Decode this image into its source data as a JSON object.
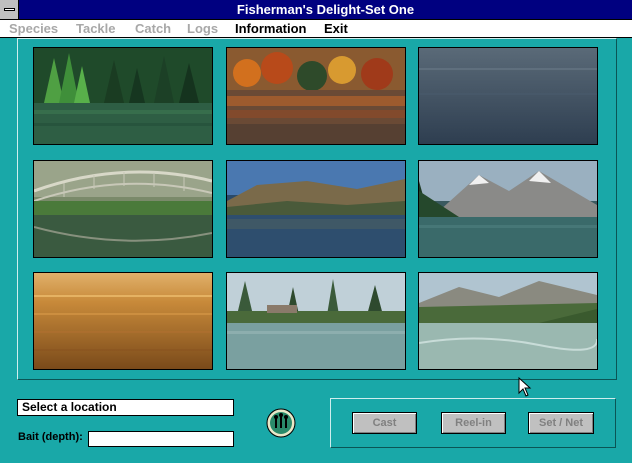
{
  "window": {
    "title": "Fisherman's Delight-Set One"
  },
  "menu": [
    {
      "label": "Species",
      "enabled": false
    },
    {
      "label": "Tackle",
      "enabled": false
    },
    {
      "label": "Catch",
      "enabled": false
    },
    {
      "label": "Logs",
      "enabled": false
    },
    {
      "label": "Information",
      "enabled": true
    },
    {
      "label": "Exit",
      "enabled": true
    }
  ],
  "locations": [
    {
      "scene": "pine-forest-lake-shore"
    },
    {
      "scene": "autumn-foliage-reflection"
    },
    {
      "scene": "open-water"
    },
    {
      "scene": "bridge-over-river"
    },
    {
      "scene": "lake-with-hills"
    },
    {
      "scene": "mountain-lake"
    },
    {
      "scene": "sunset-water"
    },
    {
      "scene": "lake-shore-with-trees"
    },
    {
      "scene": "mountain-river"
    }
  ],
  "status": {
    "prompt": "Select a location"
  },
  "bait": {
    "label": "Bait (depth):",
    "value": ""
  },
  "buttons": {
    "cast": "Cast",
    "reel_in": "Reel-in",
    "set_net": "Set / Net"
  },
  "colors": {
    "background": "#19a8a8",
    "titlebar": "#000080",
    "disabled_text": "#a8a8a8"
  }
}
